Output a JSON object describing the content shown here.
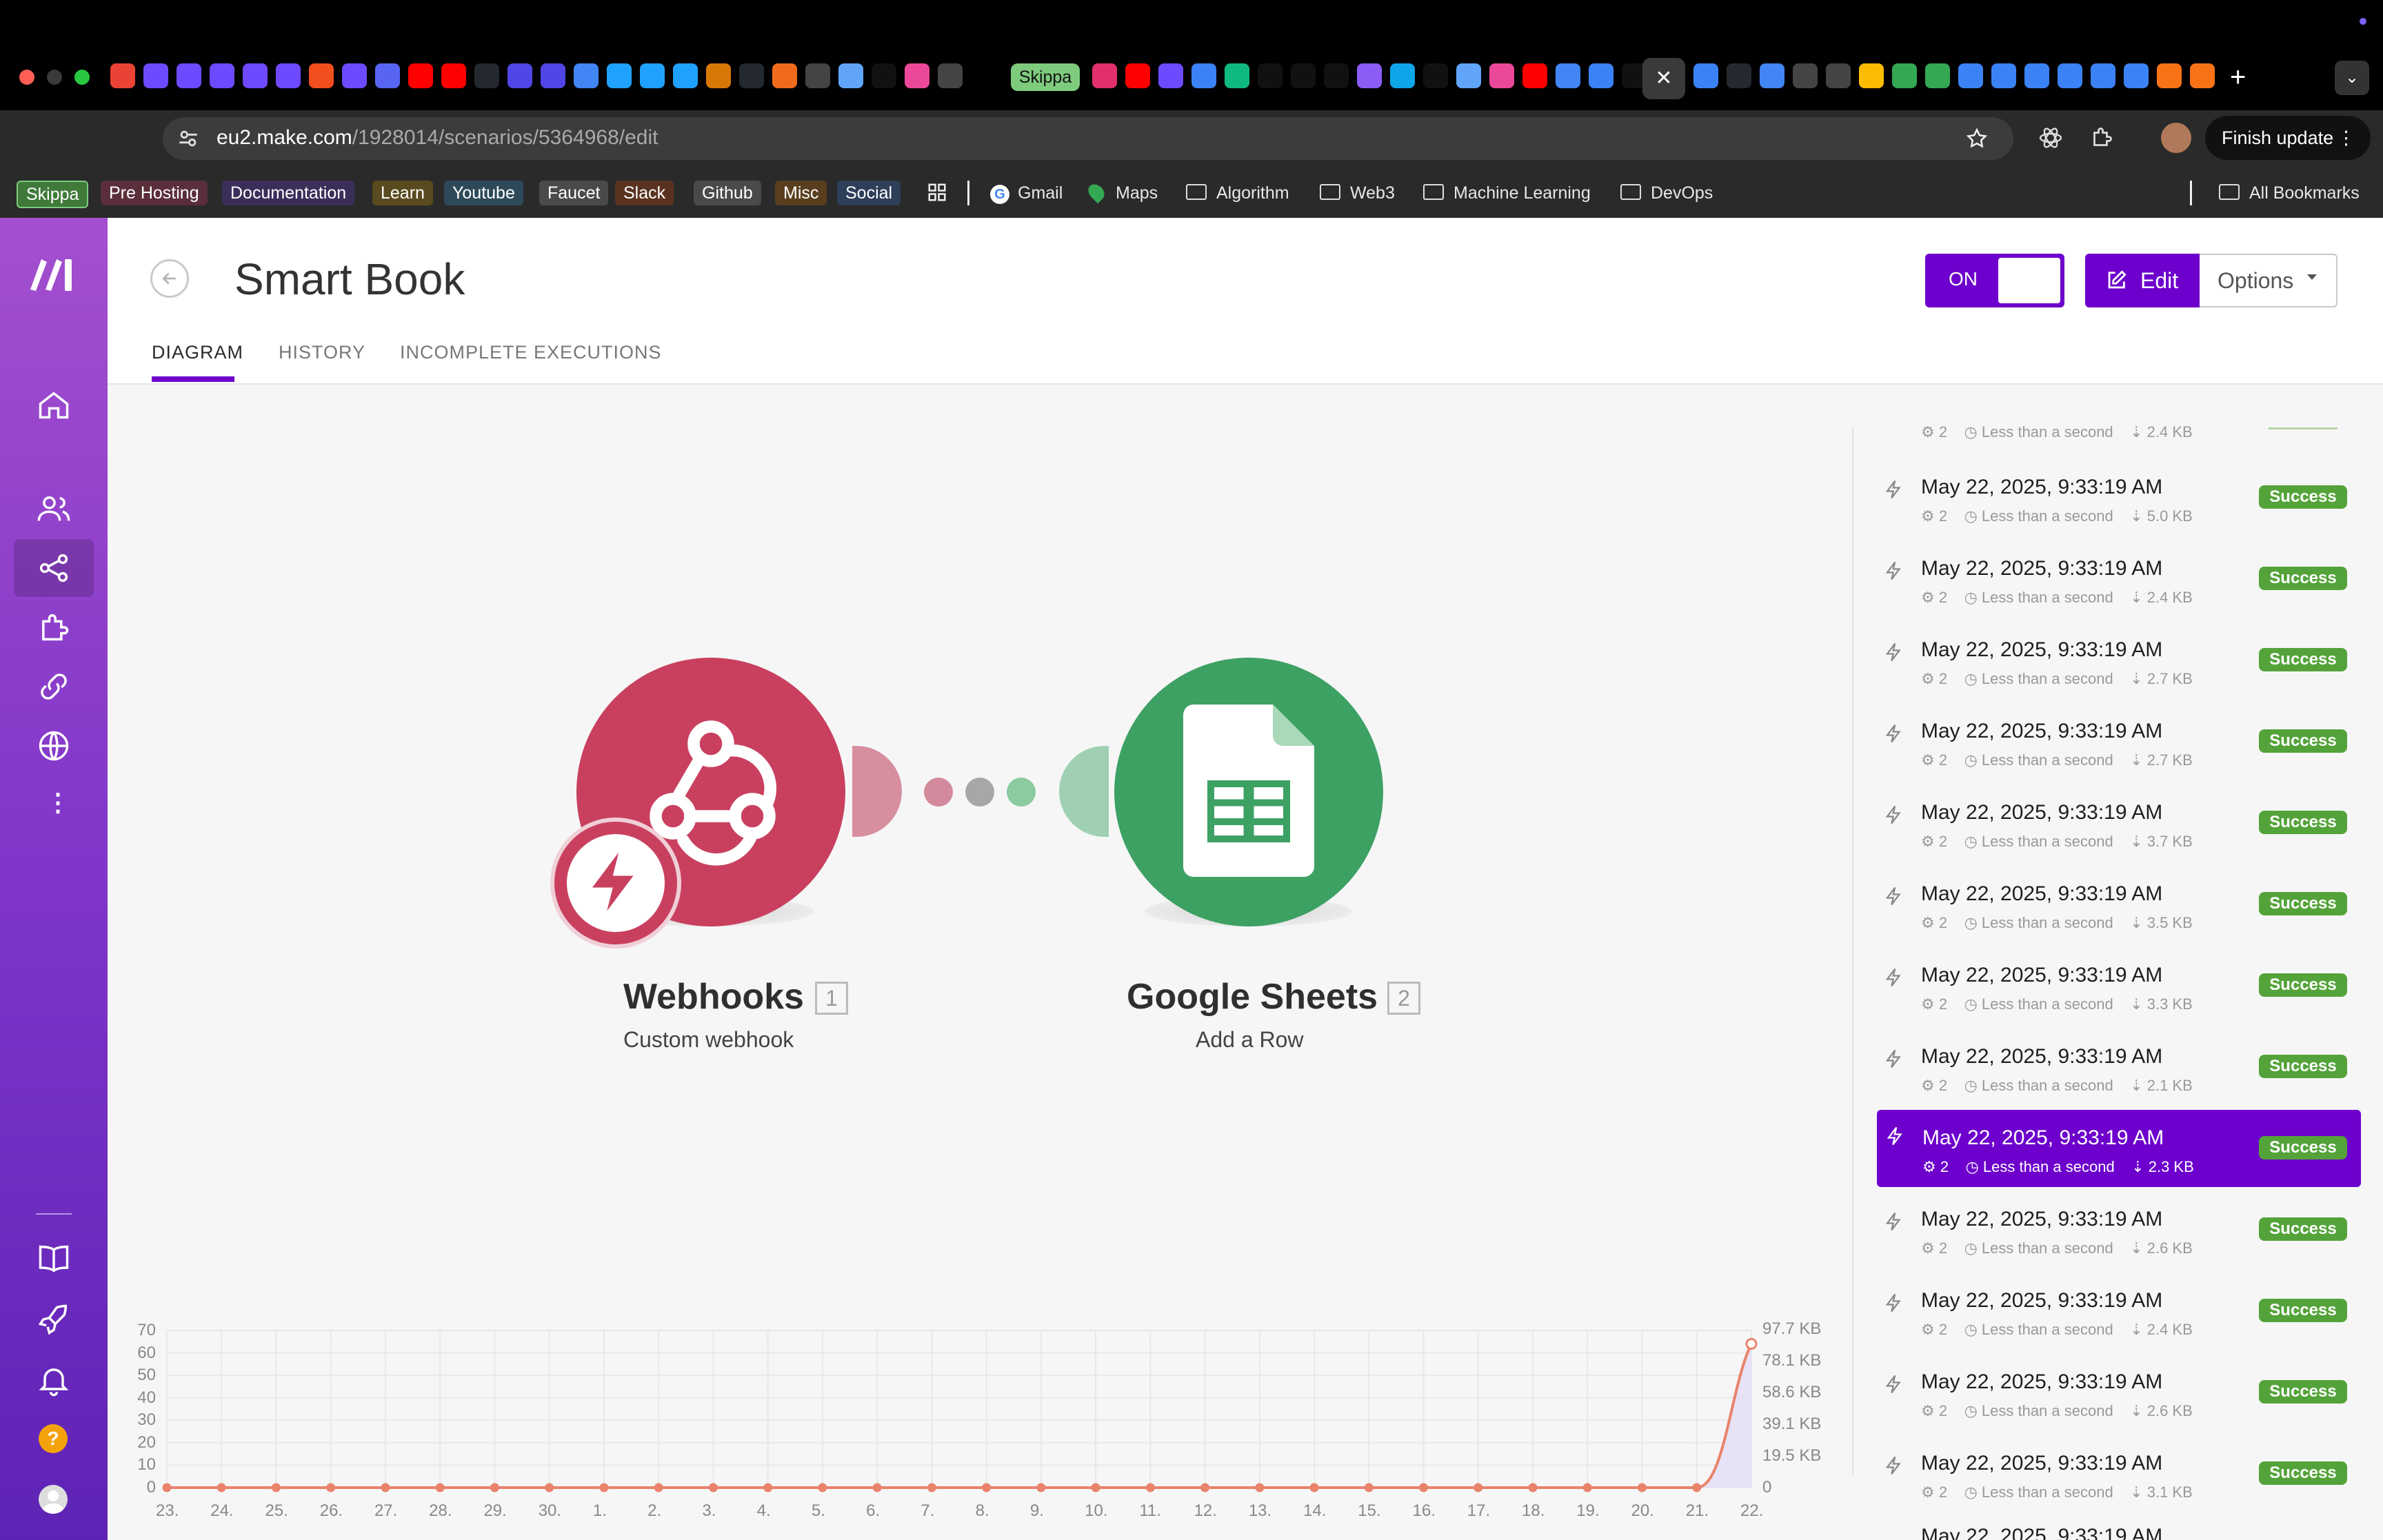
{
  "browser": {
    "url_domain": "eu2.make.com",
    "url_path": "/1928014/scenarios/5364968/edit",
    "tab_skippa": "Skippa",
    "finish_update": "Finish update",
    "bookmarks_chips": [
      "Skippa",
      "Pre Hosting",
      "Documentation",
      "Learn",
      "Youtube",
      "Faucet",
      "Slack",
      "Github",
      "Misc",
      "Social"
    ],
    "bookmarks_links": [
      "Gmail",
      "Maps"
    ],
    "bookmarks_folders": [
      "Algorithm",
      "Web3",
      "Machine Learning",
      "DevOps"
    ],
    "all_bookmarks": "All Bookmarks"
  },
  "scenario": {
    "title": "Smart Book",
    "toggle_label": "ON",
    "edit_label": "Edit",
    "options_label": "Options",
    "tabs": [
      "DIAGRAM",
      "HISTORY",
      "INCOMPLETE EXECUTIONS"
    ],
    "active_tab": "DIAGRAM"
  },
  "modules": [
    {
      "name": "Webhooks",
      "number": "1",
      "action": "Custom webhook",
      "color": "#c9405f"
    },
    {
      "name": "Google Sheets",
      "number": "2",
      "action": "Add a Row",
      "color": "#3ea164"
    }
  ],
  "history": {
    "partial_top": {
      "ops": "2",
      "duration": "Less than a second",
      "size": "2.4 KB"
    },
    "rows": [
      {
        "time": "May 22, 2025, 9:33:19 AM",
        "ops": "2",
        "duration": "Less than a second",
        "size": "5.0 KB",
        "status": "Success"
      },
      {
        "time": "May 22, 2025, 9:33:19 AM",
        "ops": "2",
        "duration": "Less than a second",
        "size": "2.4 KB",
        "status": "Success"
      },
      {
        "time": "May 22, 2025, 9:33:19 AM",
        "ops": "2",
        "duration": "Less than a second",
        "size": "2.7 KB",
        "status": "Success"
      },
      {
        "time": "May 22, 2025, 9:33:19 AM",
        "ops": "2",
        "duration": "Less than a second",
        "size": "2.7 KB",
        "status": "Success"
      },
      {
        "time": "May 22, 2025, 9:33:19 AM",
        "ops": "2",
        "duration": "Less than a second",
        "size": "3.7 KB",
        "status": "Success"
      },
      {
        "time": "May 22, 2025, 9:33:19 AM",
        "ops": "2",
        "duration": "Less than a second",
        "size": "3.5 KB",
        "status": "Success"
      },
      {
        "time": "May 22, 2025, 9:33:19 AM",
        "ops": "2",
        "duration": "Less than a second",
        "size": "3.3 KB",
        "status": "Success"
      },
      {
        "time": "May 22, 2025, 9:33:19 AM",
        "ops": "2",
        "duration": "Less than a second",
        "size": "2.1 KB",
        "status": "Success"
      },
      {
        "time": "May 22, 2025, 9:33:19 AM",
        "ops": "2",
        "duration": "Less than a second",
        "size": "2.3 KB",
        "status": "Success",
        "selected": true
      },
      {
        "time": "May 22, 2025, 9:33:19 AM",
        "ops": "2",
        "duration": "Less than a second",
        "size": "2.6 KB",
        "status": "Success"
      },
      {
        "time": "May 22, 2025, 9:33:19 AM",
        "ops": "2",
        "duration": "Less than a second",
        "size": "2.4 KB",
        "status": "Success"
      },
      {
        "time": "May 22, 2025, 9:33:19 AM",
        "ops": "2",
        "duration": "Less than a second",
        "size": "2.6 KB",
        "status": "Success"
      },
      {
        "time": "May 22, 2025, 9:33:19 AM",
        "ops": "2",
        "duration": "Less than a second",
        "size": "3.1 KB",
        "status": "Success"
      }
    ],
    "partial_bottom_time": "May 22, 2025, 9:33:19 AM"
  },
  "chart_data": {
    "type": "line",
    "x": [
      "23.",
      "24.",
      "25.",
      "26.",
      "27.",
      "28.",
      "29.",
      "30.",
      "1.",
      "2.",
      "3.",
      "4.",
      "5.",
      "6.",
      "7.",
      "8.",
      "9.",
      "10.",
      "11.",
      "12.",
      "13.",
      "14.",
      "15.",
      "16.",
      "17.",
      "18.",
      "19.",
      "20.",
      "21.",
      "22."
    ],
    "left_ticks": [
      "0",
      "10",
      "20",
      "30",
      "40",
      "50",
      "60",
      "70"
    ],
    "right_ticks": [
      "0",
      "19.5 KB",
      "39.1 KB",
      "58.6 KB",
      "78.1 KB",
      "97.7 KB"
    ],
    "ylim": [
      0,
      70
    ],
    "series": [
      {
        "values": [
          0,
          0,
          0,
          0,
          0,
          0,
          0,
          0,
          0,
          0,
          0,
          0,
          0,
          0,
          0,
          0,
          0,
          0,
          0,
          0,
          0,
          0,
          0,
          0,
          0,
          0,
          0,
          0,
          0,
          64
        ],
        "color": "#e9836b"
      }
    ],
    "grid": true
  },
  "colors": {
    "accent": "#6d00cc",
    "success": "#54a33a"
  }
}
